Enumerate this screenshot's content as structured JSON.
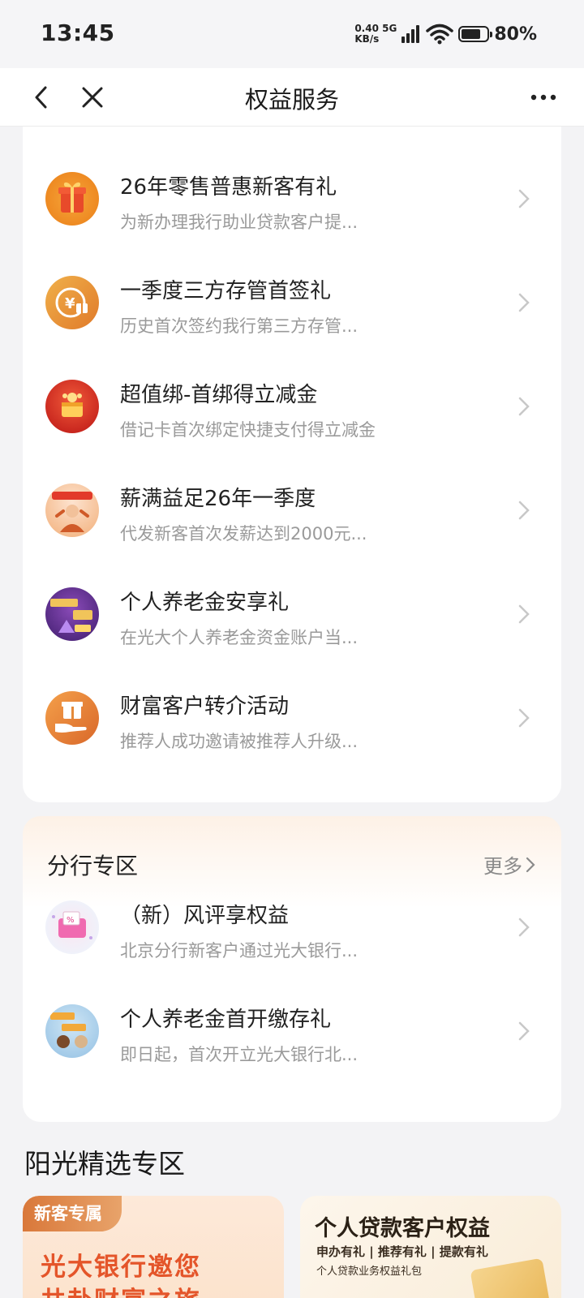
{
  "status_bar": {
    "time": "13:45",
    "net_speed_value": "0.40",
    "net_speed_unit": "KB/s",
    "network": "5G",
    "battery": "80%"
  },
  "nav": {
    "title": "权益服务",
    "back_icon": "chevron-left-icon",
    "close_icon": "close-icon",
    "more_icon": "more-dots-icon"
  },
  "activity_list": [
    {
      "title": "26年零售普惠新客有礼",
      "subtitle": "为新办理我行助业贷款客户提...",
      "icon": "gift-box-icon"
    },
    {
      "title": "一季度三方存管首签礼",
      "subtitle": "历史首次签约我行第三方存管...",
      "icon": "yuan-gift-icon"
    },
    {
      "title": "超值绑-首绑得立减金",
      "subtitle": "借记卡首次绑定快捷支付得立减金",
      "icon": "treasure-icon"
    },
    {
      "title": "薪满益足26年一季度",
      "subtitle": "代发新客首次发薪达到2000元...",
      "icon": "salary-promo-icon"
    },
    {
      "title": "个人养老金安享礼",
      "subtitle": "在光大个人养老金资金账户当...",
      "icon": "pension-promo-icon"
    },
    {
      "title": "财富客户转介活动",
      "subtitle": "推荐人成功邀请被推荐人升级...",
      "icon": "hand-gift-icon"
    }
  ],
  "branch_section": {
    "title": "分行专区",
    "more": "更多",
    "items": [
      {
        "title": "（新）风评享权益",
        "subtitle": "北京分行新客户通过光大银行...",
        "icon": "risk-coupon-icon"
      },
      {
        "title": "个人养老金首开缴存礼",
        "subtitle": "即日起，首次开立光大银行北...",
        "icon": "pension-open-icon"
      }
    ]
  },
  "sunshine_zone": {
    "title": "阳光精选专区",
    "banner1": {
      "tag": "新客专属",
      "line1": "光大银行邀您",
      "line2": "共赴财富之旅"
    },
    "banner2": {
      "title": "个人贷款客户权益",
      "sub1": "申办有礼 | 推荐有礼 | 提款有礼",
      "sub2": "个人贷款业务权益礼包"
    }
  },
  "colors": {
    "accent_orange": "#e4552a",
    "page_bg": "#f3f3f5",
    "subtitle_gray": "#9a9a9a"
  }
}
